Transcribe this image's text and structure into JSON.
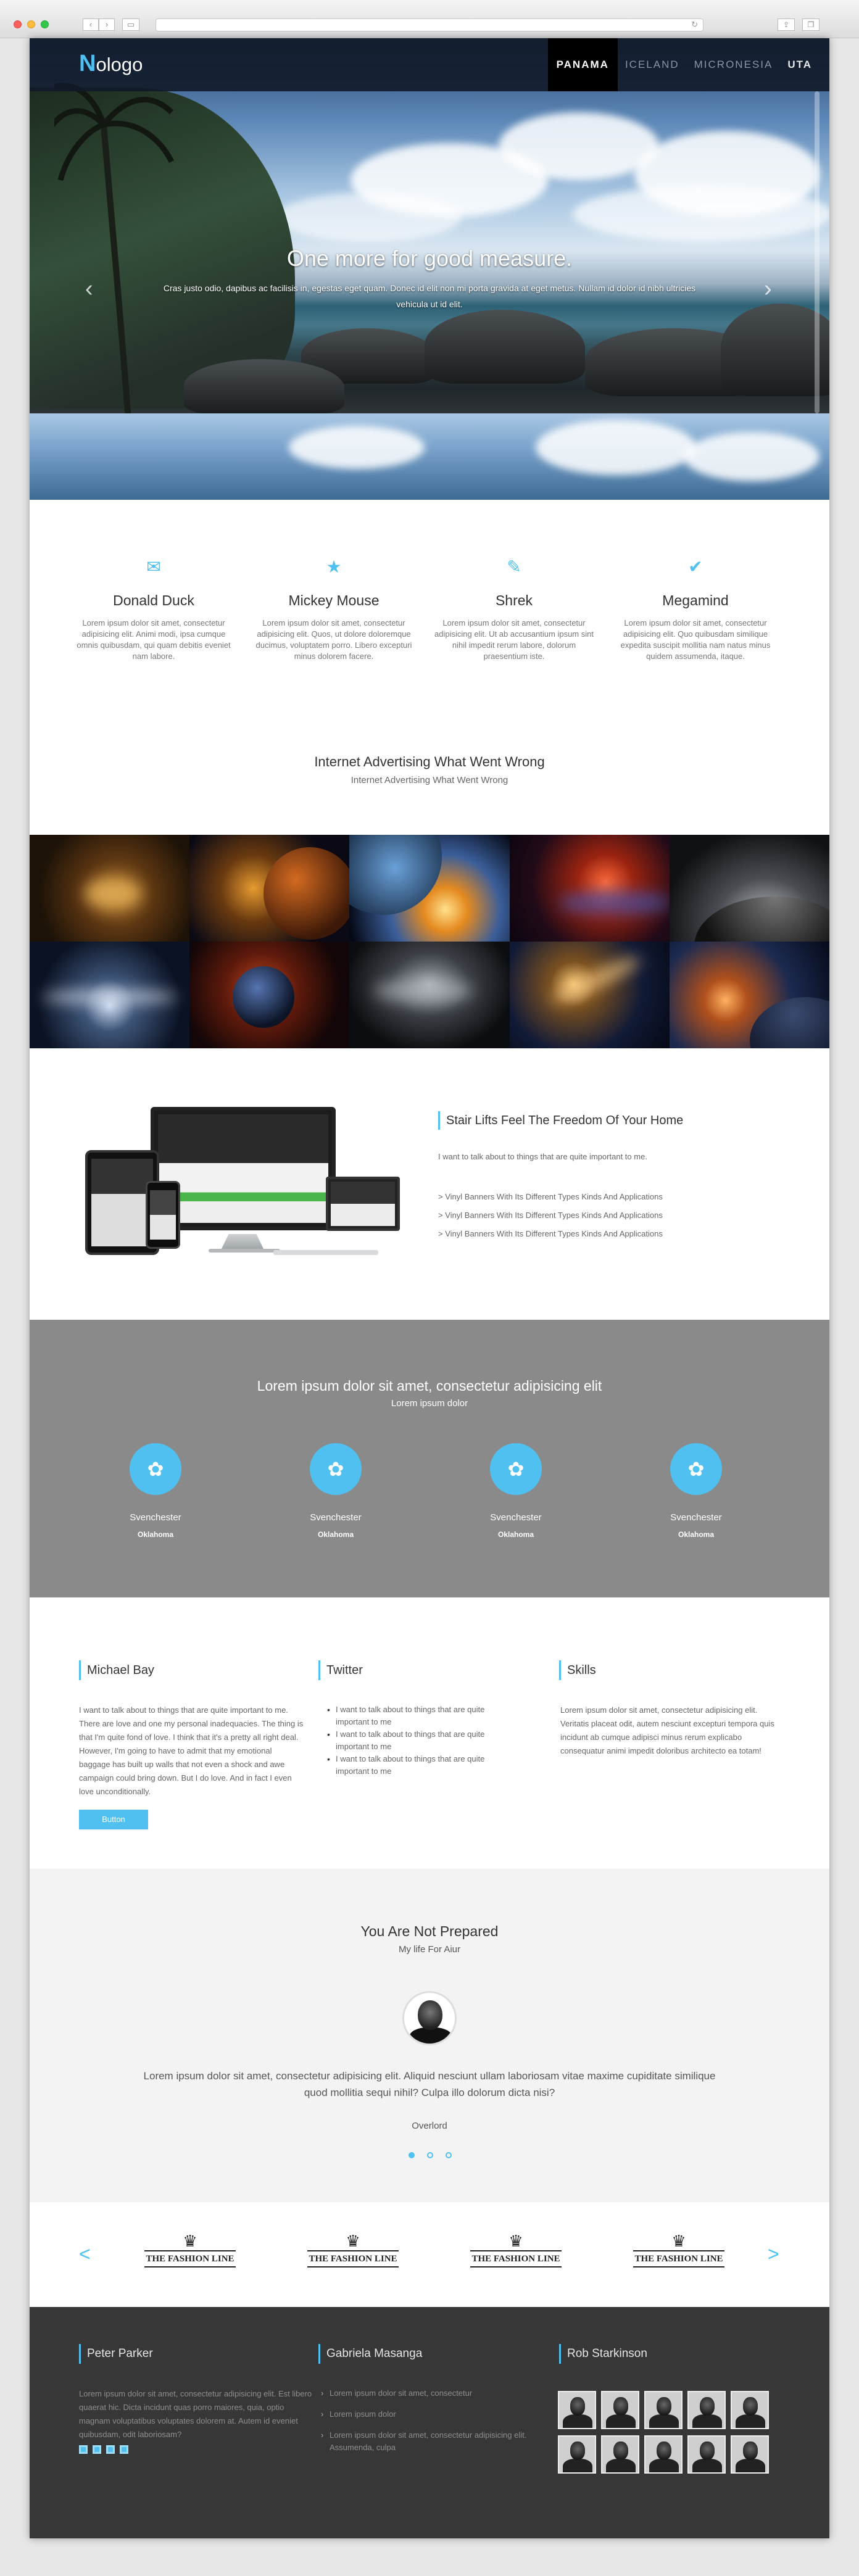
{
  "site": {
    "logo_letter": "N",
    "logo_rest": "ologo",
    "menu": [
      "PANAMA",
      "ICELAND",
      "MICRONESIA",
      "UTA"
    ]
  },
  "hero": {
    "title": "One more for good measure.",
    "text": "Cras justo odio, dapibus ac facilisis in, egestas eget quam. Donec id elit non mi porta gravida at eget metus. Nullam id dolor id nibh ultricies vehicula ut id elit.",
    "prev": "‹",
    "next": "›"
  },
  "features": [
    {
      "icon": "✉",
      "title": "Donald Duck",
      "text": "Lorem ipsum dolor sit amet, consectetur adipisicing elit. Animi modi, ipsa cumque omnis quibusdam, qui quam debitis eveniet nam labore."
    },
    {
      "icon": "★",
      "title": "Mickey Mouse",
      "text": "Lorem ipsum dolor sit amet, consectetur adipisicing elit. Quos, ut dolore doloremque ducimus, voluptatem porro. Libero excepturi minus dolorem facere."
    },
    {
      "icon": "✎",
      "title": "Shrek",
      "text": "Lorem ipsum dolor sit amet, consectetur adipisicing elit. Ut ab accusantium ipsum sint nihil impedit rerum labore, dolorum praesentium iste."
    },
    {
      "icon": "✔",
      "title": "Megamind",
      "text": "Lorem ipsum dolor sit amet, consectetur adipisicing elit. Quo quibusdam similique expedita suscipit mollitia nam natus minus quidem assumenda, itaque."
    }
  ],
  "tagline": {
    "title": "Internet Advertising What Went Wrong",
    "subtitle": "Internet Advertising What Went Wrong"
  },
  "devices": {
    "title": "Stair Lifts Feel The Freedom Of Your Home",
    "intro": "I want to talk about to things that are quite important to me.",
    "items": [
      "Vinyl Banners With Its Different Types Kinds And Applications",
      "Vinyl Banners With Its Different Types Kinds And Applications",
      "Vinyl Banners With Its Different Types Kinds And Applications"
    ]
  },
  "gray": {
    "title": "Lorem ipsum dolor sit amet, consectetur adipisicing elit",
    "subtitle": "Lorem ipsum dolor",
    "items": [
      {
        "name": "Svenchester",
        "place": "Oklahoma"
      },
      {
        "name": "Svenchester",
        "place": "Oklahoma"
      },
      {
        "name": "Svenchester",
        "place": "Oklahoma"
      },
      {
        "name": "Svenchester",
        "place": "Oklahoma"
      }
    ]
  },
  "cols": {
    "col1_title": "Michael Bay",
    "col1_text": "I want to talk about to things that are quite important to me. There are love and one my personal inadequacies. The thing is that I'm quite fond of love. I think that it's a pretty all right deal. However, I'm going to have to admit that my emotional baggage has built up walls that not even a shock and awe campaign could bring down. But I do love. And in fact I even love unconditionally.",
    "button": "Button",
    "col2_title": "Twitter",
    "col2_items": [
      "I want to talk about to things that are quite important to me",
      "I want to talk about to things that are quite important to me",
      "I want to talk about to things that are quite important to me"
    ],
    "col3_title": "Skills",
    "col3_text": "Lorem ipsum dolor sit amet, consectetur adipisicing elit. Veritatis placeat odit, autem nesciunt excepturi tempora quis incidunt ab cumque adipisci minus rerum explicabo consequatur animi impedit doloribus architecto ea totam!"
  },
  "testimonial": {
    "title": "You Are Not Prepared",
    "subtitle": "My life For Aiur",
    "quote": "Lorem ipsum dolor sit amet, consectetur adipisicing elit. Aliquid nesciunt ullam laboriosam vitae maxime cupiditate similique quod mollitia sequi nihil? Culpa illo dolorum dicta nisi?",
    "author": "Overlord"
  },
  "logos": {
    "prev": "<",
    "next": ">",
    "crown": "♛",
    "brands": [
      "THE FASHION LINE",
      "THE FASHION LINE",
      "THE FASHION LINE",
      "THE FASHION LINE"
    ]
  },
  "footer": {
    "col1_title": "Peter Parker",
    "col1_text": "Lorem ipsum dolor sit amet, consectetur adipisicing elit. Est libero quaerat hic. Dicta incidunt quas porro maiores, quia, optio magnam voluptatibus voluptates dolorem at. Autem id eveniet quibusdam, odit laboriosam?",
    "col2_title": "Gabriela Masanga",
    "col2_items": [
      "Lorem ipsum dolor sit amet, consectetur",
      "Lorem ipsum dolor",
      "Lorem ipsum dolor sit amet, consectetur adipisicing elit. Assumenda, culpa"
    ],
    "col3_title": "Rob Starkinson"
  },
  "colors": {
    "accent": "#4fc0f0",
    "gray_band": "#8a8a8a",
    "footer": "#373737"
  }
}
